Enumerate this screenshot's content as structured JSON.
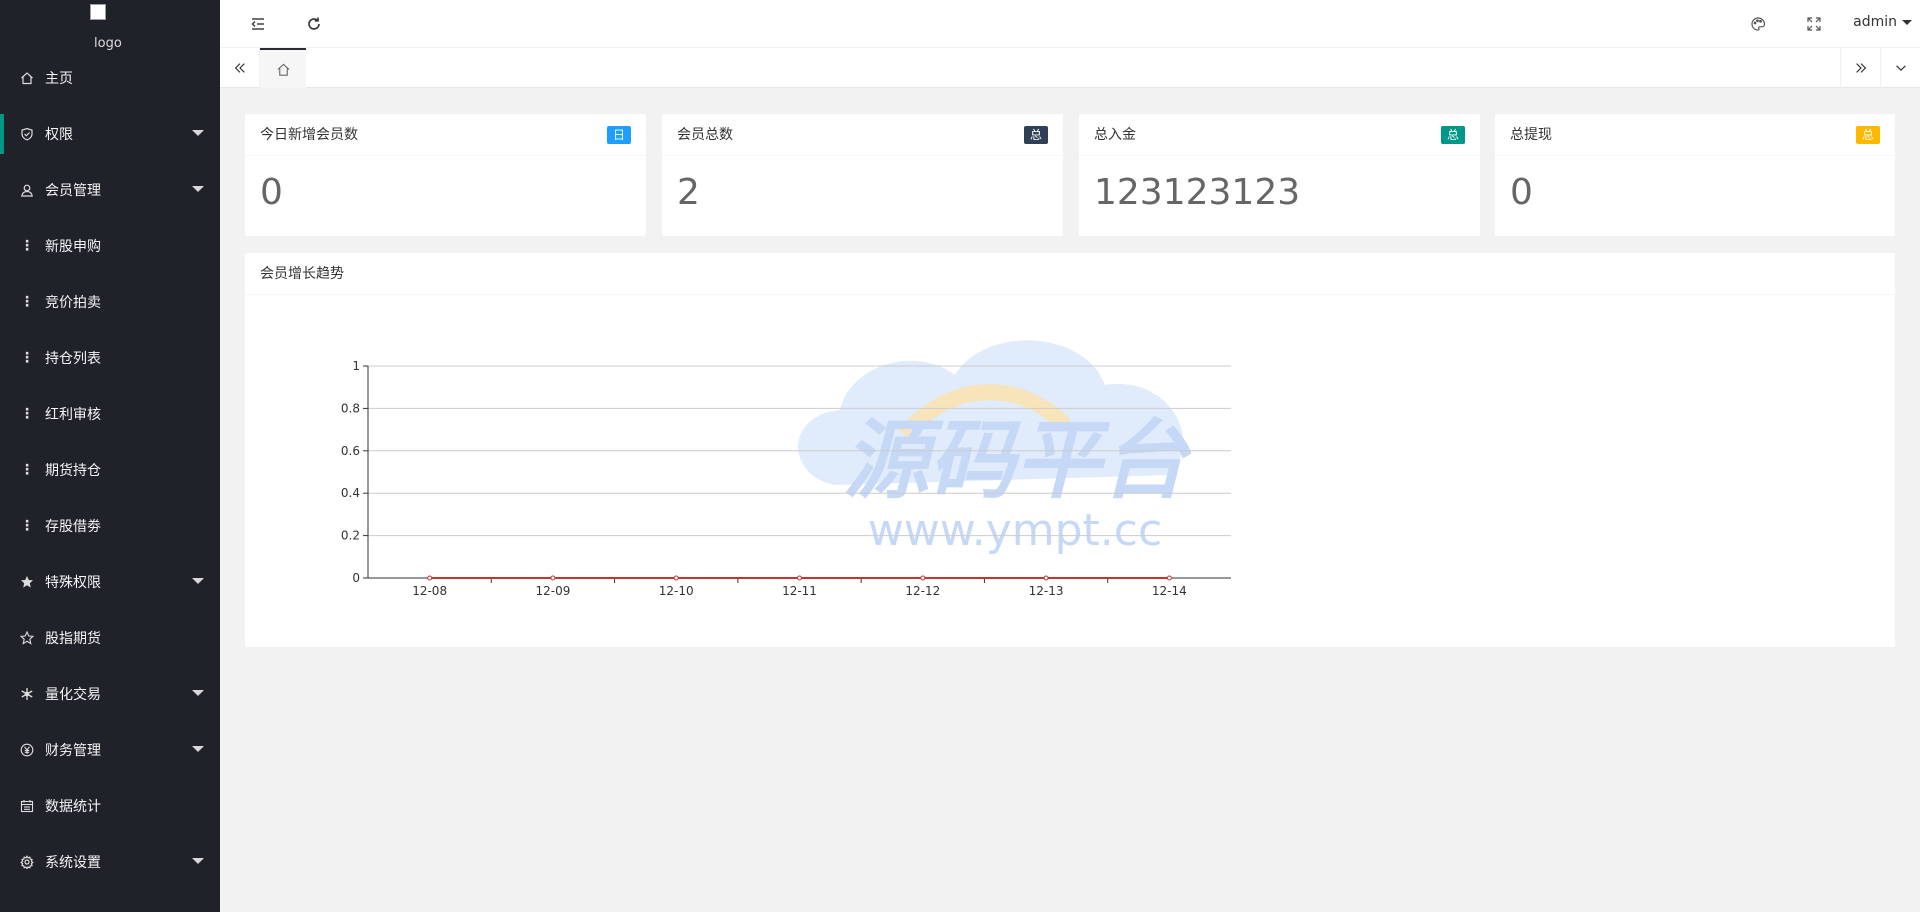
{
  "sidebar": {
    "logo_alt": "logo",
    "items": [
      {
        "label": "主页",
        "icon": "home-icon"
      },
      {
        "label": "权限",
        "icon": "shield-icon"
      },
      {
        "label": "会员管理",
        "icon": "user-icon"
      },
      {
        "label": "新股申购",
        "icon": "dots-icon"
      },
      {
        "label": "竞价拍卖",
        "icon": "dots-icon"
      },
      {
        "label": "持仓列表",
        "icon": "dots-icon"
      },
      {
        "label": "红利审核",
        "icon": "dots-icon"
      },
      {
        "label": "期货持仓",
        "icon": "dots-icon"
      },
      {
        "label": "存股借劵",
        "icon": "dots-icon"
      },
      {
        "label": "特殊权限",
        "icon": "star-filled-icon"
      },
      {
        "label": "股指期货",
        "icon": "star-outline-icon"
      },
      {
        "label": "量化交易",
        "icon": "snowflake-icon"
      },
      {
        "label": "财务管理",
        "icon": "yen-icon"
      },
      {
        "label": "数据统计",
        "icon": "calendar-icon"
      },
      {
        "label": "系统设置",
        "icon": "gear-icon"
      }
    ]
  },
  "header": {
    "user": "admin"
  },
  "stats": [
    {
      "title": "今日新增会员数",
      "badge": "日",
      "badge_color": "#1E9FFF",
      "value": "0"
    },
    {
      "title": "会员总数",
      "badge": "总",
      "badge_color": "#2F4056",
      "value": "2"
    },
    {
      "title": "总入金",
      "badge": "总",
      "badge_color": "#009688",
      "value": "123123123"
    },
    {
      "title": "总提现",
      "badge": "总",
      "badge_color": "#FFB800",
      "value": "0"
    }
  ],
  "chart_panel": {
    "title": "会员增长趋势"
  },
  "watermark": {
    "title": "源码平台",
    "url": "www.ympt.cc"
  },
  "chart_data": {
    "type": "line",
    "categories": [
      "12-08",
      "12-09",
      "12-10",
      "12-11",
      "12-12",
      "12-13",
      "12-14"
    ],
    "series": [
      {
        "values": [
          0,
          0,
          0,
          0,
          0,
          0,
          0
        ],
        "color": "#c23531"
      }
    ],
    "yticks": [
      "0",
      "0.2",
      "0.4",
      "0.6",
      "0.8",
      "1"
    ],
    "ylim": [
      0,
      1
    ],
    "grid": true
  }
}
